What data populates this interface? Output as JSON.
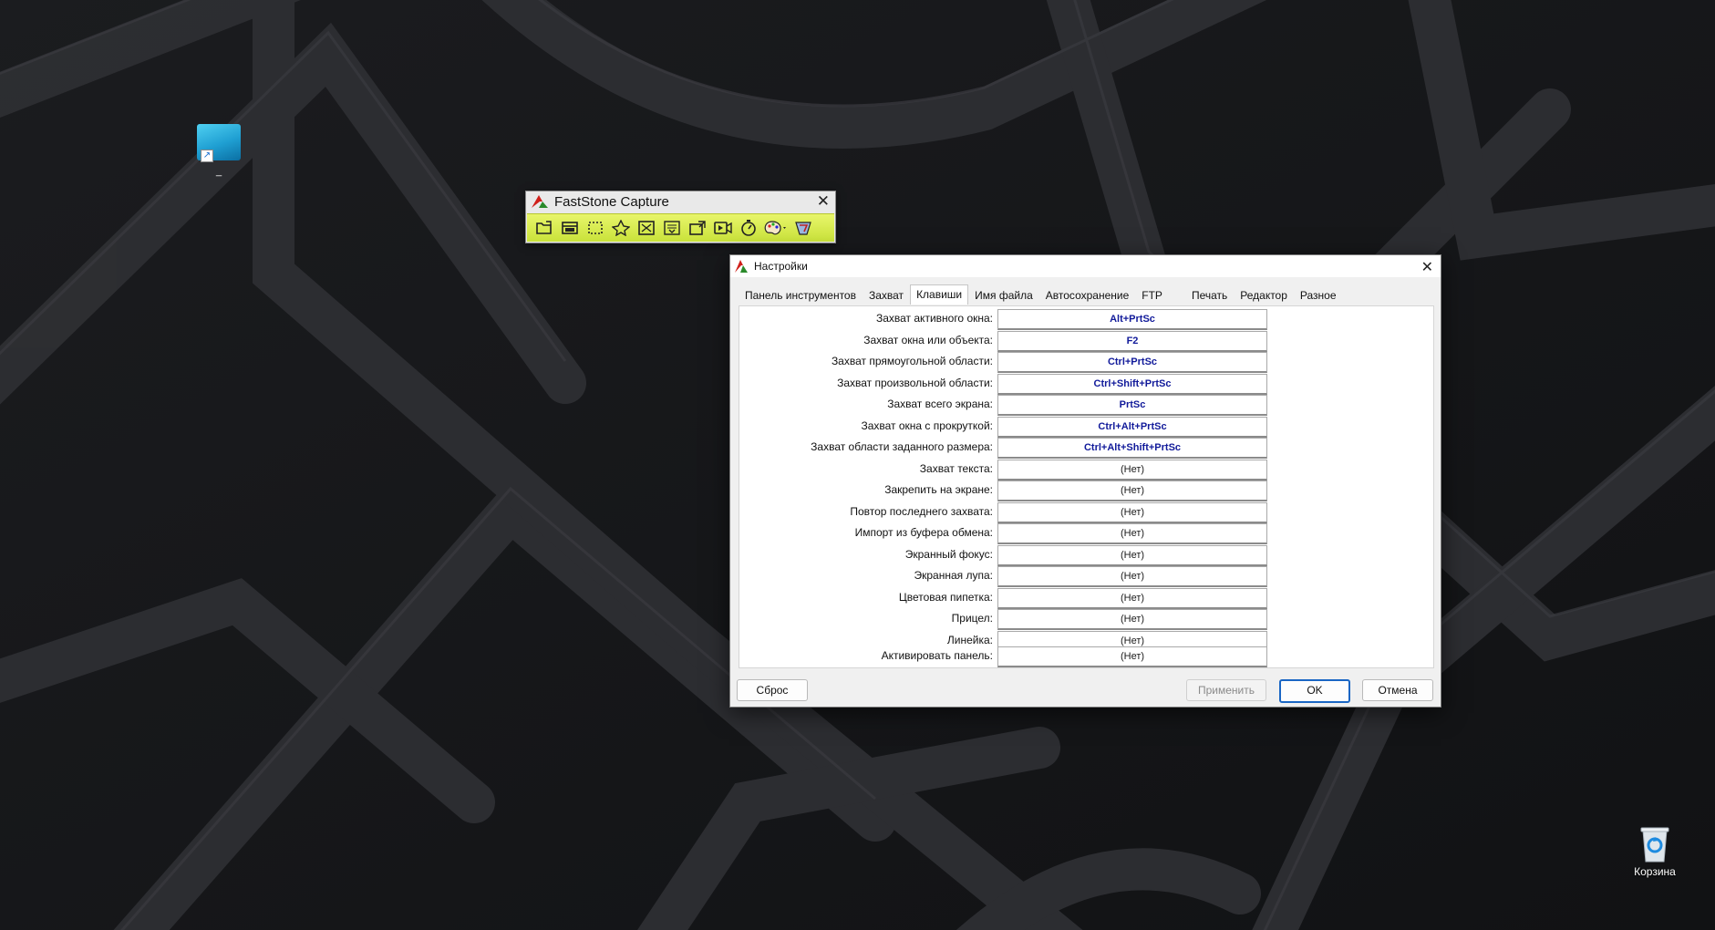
{
  "desktop": {
    "shortcut_label": "_",
    "recycle_bin_label": "Корзина"
  },
  "faststone_bar": {
    "title": "FastStone Capture",
    "tools": [
      {
        "icon": "open-folder-icon"
      },
      {
        "icon": "capture-window-icon"
      },
      {
        "icon": "capture-rectangle-icon"
      },
      {
        "icon": "capture-freehand-icon"
      },
      {
        "icon": "capture-fullscreen-icon"
      },
      {
        "icon": "capture-scrolling-icon"
      },
      {
        "icon": "capture-fixed-region-icon"
      },
      {
        "icon": "screen-recorder-icon"
      },
      {
        "icon": "delay-timer-icon"
      },
      {
        "icon": "output-palette-icon"
      },
      {
        "icon": "settings-icon"
      }
    ]
  },
  "dialog": {
    "title": "Настройки",
    "tabs": [
      {
        "label": "Панель инструментов",
        "active": false
      },
      {
        "label": "Захват",
        "active": false
      },
      {
        "label": "Клавиши",
        "active": true
      },
      {
        "label": "Имя файла",
        "active": false
      },
      {
        "label": "Автосохранение",
        "active": false
      },
      {
        "label": "FTP",
        "active": false
      },
      {
        "label": "Печать",
        "active": false
      },
      {
        "label": "Редактор",
        "active": false
      },
      {
        "label": "Разное",
        "active": false
      }
    ],
    "hotkeys": [
      {
        "label": "Захват активного окна:",
        "value": "Alt+PrtSc",
        "set": true
      },
      {
        "label": "Захват окна или объекта:",
        "value": "F2",
        "set": true
      },
      {
        "label": "Захват прямоугольной области:",
        "value": "Ctrl+PrtSc",
        "set": true
      },
      {
        "label": "Захват произвольной области:",
        "value": "Ctrl+Shift+PrtSc",
        "set": true
      },
      {
        "label": "Захват всего экрана:",
        "value": "PrtSc",
        "set": true
      },
      {
        "label": "Захват окна с прокруткой:",
        "value": "Ctrl+Alt+PrtSc",
        "set": true
      },
      {
        "label": "Захват области заданного размера:",
        "value": "Ctrl+Alt+Shift+PrtSc",
        "set": true
      },
      {
        "label": "Захват текста:",
        "value": "(Нет)",
        "set": false
      },
      {
        "label": "Закрепить на экране:",
        "value": "(Нет)",
        "set": false
      },
      {
        "label": "Повтор последнего захвата:",
        "value": "(Нет)",
        "set": false
      },
      {
        "label": "Импорт из буфера обмена:",
        "value": "(Нет)",
        "set": false
      },
      {
        "label": "Экранный фокус:",
        "value": "(Нет)",
        "set": false
      },
      {
        "label": "Экранная лупа:",
        "value": "(Нет)",
        "set": false
      },
      {
        "label": "Цветовая пипетка:",
        "value": "(Нет)",
        "set": false
      },
      {
        "label": "Прицел:",
        "value": "(Нет)",
        "set": false
      },
      {
        "label": "Линейка:",
        "value": "(Нет)",
        "set": false
      },
      {
        "label": "Активировать панель:",
        "value": "(Нет)",
        "set": false
      }
    ],
    "buttons": {
      "reset": "Сброс",
      "apply": "Применить",
      "ok": "OK",
      "cancel": "Отмена"
    }
  }
}
